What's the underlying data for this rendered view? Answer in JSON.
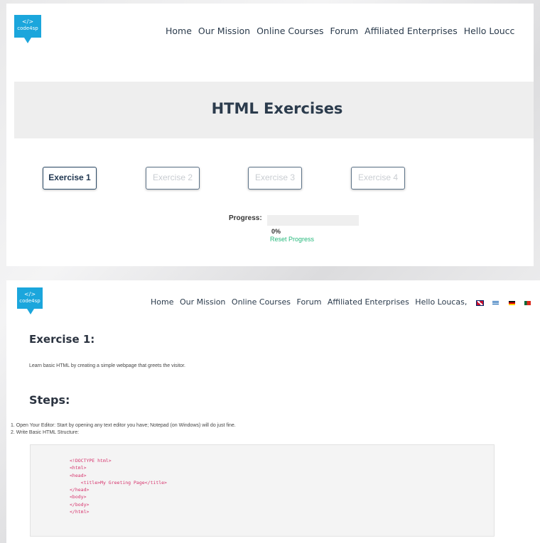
{
  "logo": {
    "glyph": "</>",
    "brand": "code4sp"
  },
  "nav_top": {
    "items": [
      "Home",
      "Our Mission",
      "Online Courses",
      "Forum",
      "Affiliated Enterprises"
    ],
    "greeting": "Hello Loucc"
  },
  "banner": {
    "title": "HTML Exercises"
  },
  "exercises": {
    "buttons": [
      {
        "label": "Exercise 1",
        "state": "active"
      },
      {
        "label": "Exercise 2",
        "state": "disabled"
      },
      {
        "label": "Exercise 3",
        "state": "disabled"
      },
      {
        "label": "Exercise 4",
        "state": "disabled"
      }
    ]
  },
  "progress": {
    "label": "Progress:",
    "value_text": "0%",
    "value": 0,
    "reset_label": "Reset Progress"
  },
  "nav_bottom": {
    "items": [
      "Home",
      "Our Mission",
      "Online Courses",
      "Forum",
      "Affiliated Enterprises"
    ],
    "greeting": "Hello Loucas,",
    "flags": [
      "uk-flag",
      "greek-flag",
      "german-flag",
      "portugal-flag"
    ]
  },
  "exercise": {
    "title": "Exercise 1:",
    "description": "Learn basic HTML by creating a simple webpage that greets the visitor.",
    "steps_title": "Steps:",
    "steps": [
      "1. Open Your Editor: Start by opening any text editor you have; Notepad (on Windows) will do just fine.",
      "2. Write Basic HTML Structure:"
    ],
    "code": "<!DOCTYPE html>\n<html>\n<head>\n    <title>My Greeting Page</title>\n</head>\n<body>\n</body>\n</html>"
  },
  "colors": {
    "brand": "#1ba6dc",
    "nav_text": "#2b3b4c",
    "progress_fill": "#2ac18b",
    "reset_link": "#27b97c",
    "code_text": "#d6336c"
  }
}
